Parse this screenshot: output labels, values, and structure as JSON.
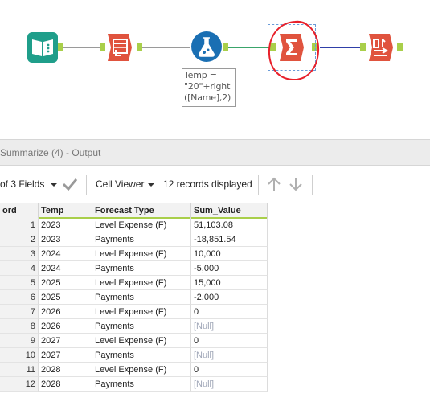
{
  "workflow": {
    "annotation": "Temp =\n\"20\"+right\n([Name],2)",
    "tools": [
      {
        "name": "input-data-tool",
        "icon": "book-icon",
        "color": "#1f9e8a"
      },
      {
        "name": "select-records-tool",
        "icon": "table-arrow-icon",
        "color": "#e0533e"
      },
      {
        "name": "formula-tool",
        "icon": "flask-icon",
        "color": "#1a6fb3"
      },
      {
        "name": "summarize-tool",
        "icon": "sigma-icon",
        "color": "#e0533e"
      },
      {
        "name": "sort-tool",
        "icon": "sort-icon",
        "color": "#e0533e"
      }
    ]
  },
  "panel": {
    "title": "Summarize (4) - Output",
    "fields_label": "of 3 Fields",
    "cell_viewer_label": "Cell Viewer",
    "records_label": "12 records displayed"
  },
  "grid": {
    "columns": [
      "ord",
      "Temp",
      "Forecast Type",
      "Sum_Value"
    ],
    "rows": [
      {
        "rec": "1",
        "temp": "2023",
        "type": "Level Expense (F)",
        "value": "51,103.08",
        "is_null": false
      },
      {
        "rec": "2",
        "temp": "2023",
        "type": "Payments",
        "value": "-18,851.54",
        "is_null": false
      },
      {
        "rec": "3",
        "temp": "2024",
        "type": "Level Expense (F)",
        "value": "10,000",
        "is_null": false
      },
      {
        "rec": "4",
        "temp": "2024",
        "type": "Payments",
        "value": "-5,000",
        "is_null": false
      },
      {
        "rec": "5",
        "temp": "2025",
        "type": "Level Expense (F)",
        "value": "15,000",
        "is_null": false
      },
      {
        "rec": "6",
        "temp": "2025",
        "type": "Payments",
        "value": "-2,000",
        "is_null": false
      },
      {
        "rec": "7",
        "temp": "2026",
        "type": "Level Expense (F)",
        "value": "0",
        "is_null": false
      },
      {
        "rec": "8",
        "temp": "2026",
        "type": "Payments",
        "value": "[Null]",
        "is_null": true
      },
      {
        "rec": "9",
        "temp": "2027",
        "type": "Level Expense (F)",
        "value": "0",
        "is_null": false
      },
      {
        "rec": "10",
        "temp": "2027",
        "type": "Payments",
        "value": "[Null]",
        "is_null": true
      },
      {
        "rec": "11",
        "temp": "2028",
        "type": "Level Expense (F)",
        "value": "0",
        "is_null": false
      },
      {
        "rec": "12",
        "temp": "2028",
        "type": "Payments",
        "value": "[Null]",
        "is_null": true
      }
    ]
  }
}
